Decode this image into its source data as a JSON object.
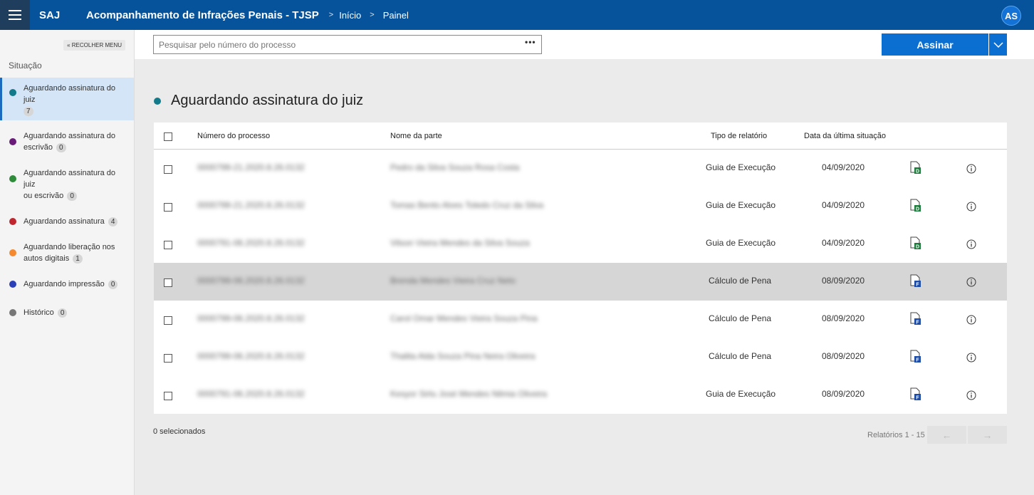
{
  "header": {
    "brand": "SAJ",
    "title": "Acompanhamento de Infrações Penais - TJSP",
    "breadcrumb_sep": ">",
    "breadcrumbs": [
      "Início",
      "Painel"
    ],
    "avatar": "AS"
  },
  "sidebar": {
    "collapse_label": "« RECOLHER MENU",
    "title": "Situação",
    "items": [
      {
        "label": "Aguardando assinatura do juiz",
        "count": "7",
        "color": "#127a8a"
      },
      {
        "label": "Aguardando assinatura do escrivão",
        "count": "0",
        "color": "#6a1b7a"
      },
      {
        "label": "Aguardando assinatura do juiz ou escrivão",
        "count": "0",
        "color": "#2e8b3a"
      },
      {
        "label": "Aguardando assinatura",
        "count": "4",
        "color": "#c0262d"
      },
      {
        "label": "Aguardando liberação nos autos digitais",
        "count": "1",
        "color": "#f4892f"
      },
      {
        "label": "Aguardando impressão",
        "count": "0",
        "color": "#2a3fb8"
      },
      {
        "label": "Histórico",
        "count": "0",
        "color": "#777777"
      }
    ]
  },
  "search": {
    "placeholder": "Pesquisar pelo número do processo",
    "more": "•••"
  },
  "actions": {
    "sign_label": "Assinar"
  },
  "main": {
    "section_title": "Aguardando assinatura do juiz",
    "columns": [
      "Número do processo",
      "Nome da parte",
      "Tipo de relatório",
      "Data da última situação"
    ],
    "rows": [
      {
        "numero": "0000799-21.2020.8.26.0132",
        "parte": "Pedro da Silva Souza Rosa Costa",
        "tipo": "Guia de Execução",
        "data": "04/09/2020",
        "icon": "D"
      },
      {
        "numero": "0000799-21.2020.8.26.0132",
        "parte": "Tomas Bento Alves Toledo Cruz da Silva",
        "tipo": "Guia de Execução",
        "data": "04/09/2020",
        "icon": "D"
      },
      {
        "numero": "0000791-06.2020.8.26.0132",
        "parte": "Vilson Vieira Mendes da Silva Souza",
        "tipo": "Guia de Execução",
        "data": "04/09/2020",
        "icon": "D"
      },
      {
        "numero": "0000799-06.2020.8.26.0132",
        "parte": "Brenda Mendes Vieira Cruz Neto",
        "tipo": "Cálculo de Pena",
        "data": "08/09/2020",
        "icon": "F"
      },
      {
        "numero": "0000799-06.2020.8.26.0132",
        "parte": "Carol Omar Mendes Vieira Souza Pina",
        "tipo": "Cálculo de Pena",
        "data": "08/09/2020",
        "icon": "F"
      },
      {
        "numero": "0000799-06.2020.8.26.0132",
        "parte": "Thalita Alda Souza Pina Neira Oliveira",
        "tipo": "Cálculo de Pena",
        "data": "08/09/2020",
        "icon": "F"
      },
      {
        "numero": "0000791-06.2020.8.26.0132",
        "parte": "Kesyor Sirlu José Mendes Nilmia Oliveira",
        "tipo": "Guia de Execução",
        "data": "08/09/2020",
        "icon": "F"
      }
    ],
    "selected_count": "0 selecionados",
    "pager_label": "Relatórios 1 - 15",
    "prev": "←",
    "next": "→"
  },
  "colors": {
    "header_bg": "#06539c",
    "primary": "#0b6fd1",
    "active_item": "#d3e5f6",
    "icon_d": "#1e7d3c",
    "icon_f": "#1f4da5"
  }
}
